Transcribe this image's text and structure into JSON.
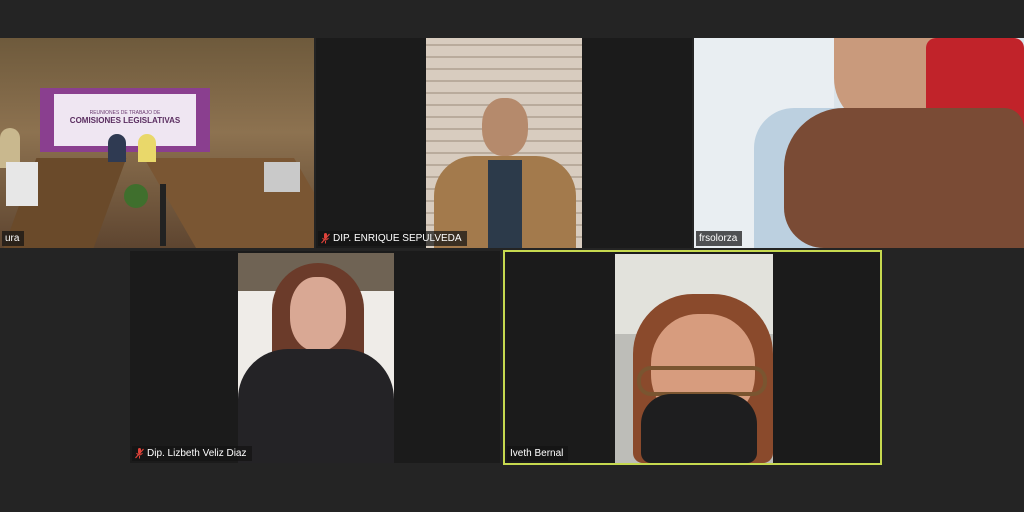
{
  "participants": [
    {
      "name": "ura",
      "muted": false,
      "active": false
    },
    {
      "name": "DIP. ENRIQUE SEPULVEDA",
      "muted": true,
      "active": false
    },
    {
      "name": "frsolorza",
      "muted": false,
      "active": false
    },
    {
      "name": "Dip. Lizbeth Veliz Diaz",
      "muted": true,
      "active": false
    },
    {
      "name": "Iveth Bernal",
      "muted": false,
      "active": true
    }
  ],
  "banner": {
    "line1": "REUNIONES DE TRABAJO DE",
    "line2": "COMISIONES LEGISLATIVAS"
  },
  "colors": {
    "background": "#242424",
    "active_border": "#c6d94f",
    "muted_icon": "#e0433a",
    "banner": "#8a3f8f"
  },
  "icons": {
    "muted": "microphone-muted-icon"
  }
}
